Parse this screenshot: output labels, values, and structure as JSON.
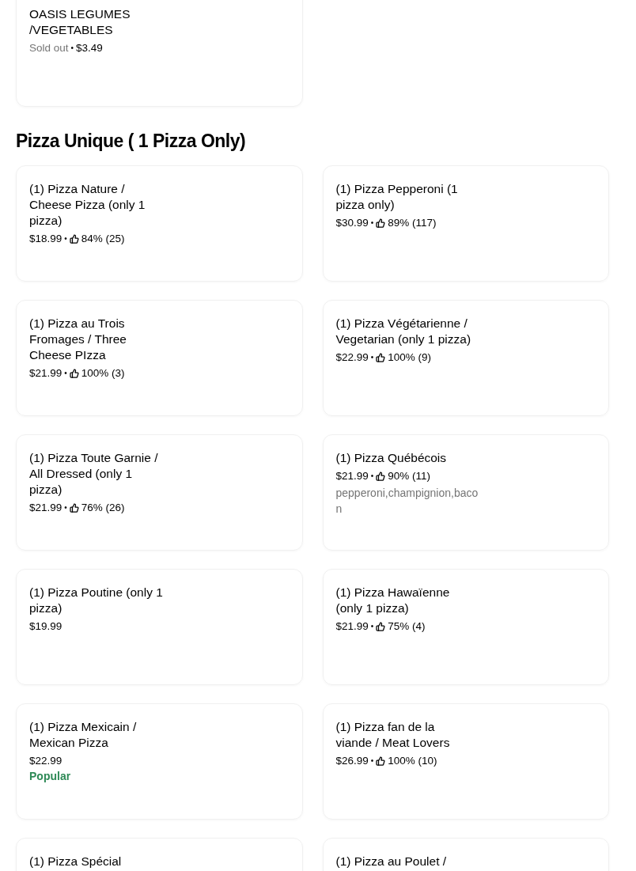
{
  "sections": [
    {
      "items": [
        {
          "name": "OASIS LEGUMES /VEGETABLES",
          "meta": [
            {
              "kind": "status",
              "text": "Sold out"
            },
            {
              "kind": "separator",
              "text": "•"
            },
            {
              "kind": "price",
              "text": "$3.49"
            }
          ]
        }
      ]
    },
    {
      "title": "Pizza Unique ( 1 Pizza Only)",
      "items": [
        {
          "name": "(1) Pizza Nature / Cheese Pizza (only 1 pizza)",
          "meta": [
            {
              "kind": "price",
              "text": "$18.99"
            },
            {
              "kind": "separator",
              "text": "•"
            },
            {
              "kind": "rating",
              "text": "84% (25)"
            }
          ]
        },
        {
          "name": "(1) Pizza Pepperoni (1 pizza only)",
          "meta": [
            {
              "kind": "price",
              "text": "$30.99"
            },
            {
              "kind": "separator",
              "text": "•"
            },
            {
              "kind": "rating",
              "text": "89% (117)"
            }
          ]
        },
        {
          "name": "(1) Pizza au Trois Fromages / Three Cheese PIzza",
          "meta": [
            {
              "kind": "price",
              "text": "$21.99"
            },
            {
              "kind": "separator",
              "text": "•"
            },
            {
              "kind": "rating",
              "text": "100% (3)"
            }
          ]
        },
        {
          "name": "(1) Pizza Végétarienne / Vegetarian (only 1 pizza)",
          "meta": [
            {
              "kind": "price",
              "text": "$22.99"
            },
            {
              "kind": "separator",
              "text": "•"
            },
            {
              "kind": "rating",
              "text": "100% (9)"
            }
          ]
        },
        {
          "name": "(1) Pizza Toute Garnie / All Dressed (only 1 pizza)",
          "meta": [
            {
              "kind": "price",
              "text": "$21.99"
            },
            {
              "kind": "separator",
              "text": "•"
            },
            {
              "kind": "rating",
              "text": "76% (26)"
            }
          ]
        },
        {
          "name": "(1) Pizza Québécois",
          "meta": [
            {
              "kind": "price",
              "text": "$21.99"
            },
            {
              "kind": "separator",
              "text": "•"
            },
            {
              "kind": "rating",
              "text": "90% (11)"
            }
          ],
          "description": "pepperoni,champignion,bacon"
        },
        {
          "name": "(1) Pizza Poutine (only 1 pizza)",
          "meta": [
            {
              "kind": "price",
              "text": "$19.99"
            }
          ]
        },
        {
          "name": "(1) Pizza Hawaïenne (only 1 pizza)",
          "meta": [
            {
              "kind": "price",
              "text": "$21.99"
            },
            {
              "kind": "separator",
              "text": "•"
            },
            {
              "kind": "rating",
              "text": "75% (4)"
            }
          ]
        },
        {
          "name": "(1) Pizza Mexicain / Mexican Pizza",
          "meta": [
            {
              "kind": "price",
              "text": "$22.99"
            }
          ],
          "badge": "Popular"
        },
        {
          "name": "(1) Pizza fan de la viande / Meat Lovers",
          "meta": [
            {
              "kind": "price",
              "text": "$26.99"
            },
            {
              "kind": "separator",
              "text": "•"
            },
            {
              "kind": "rating",
              "text": "100% (10)"
            }
          ]
        },
        {
          "name": "(1) Pizza Spécial"
        },
        {
          "name": "(1) Pizza au Poulet /"
        }
      ]
    }
  ]
}
